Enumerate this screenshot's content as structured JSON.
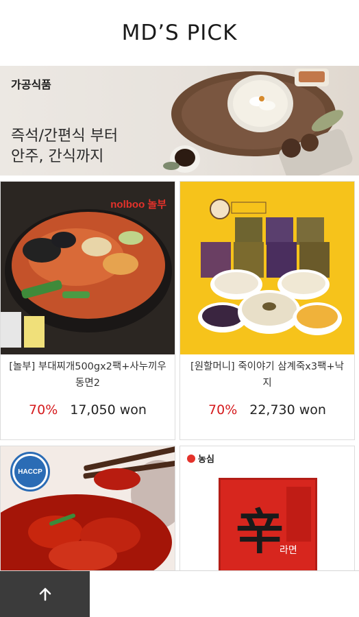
{
  "header": {
    "title": "MD’S PICK"
  },
  "banner": {
    "category": "가공식품",
    "line1": "즉석/간편식 부터",
    "line2": "안주, 간식까지"
  },
  "products": [
    {
      "brand_logo": "nolboo 놀부",
      "name": "[놀부] 부대찌개500gx2팩+사누끼우동면2",
      "discount": "70%",
      "price": "17,050 won"
    },
    {
      "brand_logo": "",
      "name": "[원할머니] 죽이야기 삼계죽x3팩+낙지",
      "discount": "70%",
      "price": "22,730 won"
    },
    {
      "badge": "HACCP"
    },
    {
      "brand_logo": "농심",
      "package_text": "辛",
      "package_sub": "라면"
    }
  ],
  "colors": {
    "discount": "#d5191c",
    "top_button": "#3b3b3b",
    "banner_bg": "#e9e4de"
  },
  "icons": {
    "top_button": "arrow-up-icon"
  }
}
